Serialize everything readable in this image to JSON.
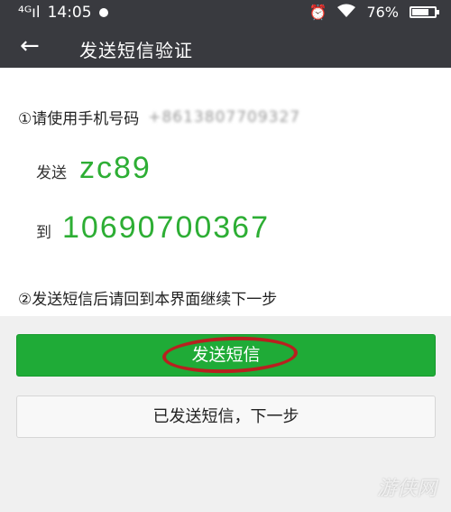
{
  "status_bar": {
    "signal": "⁴ᴳıl",
    "time": "14:05",
    "battery_percent": "76%"
  },
  "header": {
    "title": "发送短信验证",
    "back_icon": "←"
  },
  "instructions": {
    "step1_prefix": "①请使用手机号码",
    "phone_blurred": "+8613807709327",
    "send_label": "发送",
    "code": "zc89",
    "to_label": "到",
    "number": "10690700367",
    "step2": "②发送短信后请回到本界面继续下一步"
  },
  "actions": {
    "send_button": "发送短信",
    "next_button": "已发送短信，下一步"
  },
  "watermark": "游侠网",
  "colors": {
    "accent_green": "#1fab37",
    "code_green": "#2dae34",
    "highlight_ring": "#b8201f",
    "header_bg": "#393a3f"
  }
}
